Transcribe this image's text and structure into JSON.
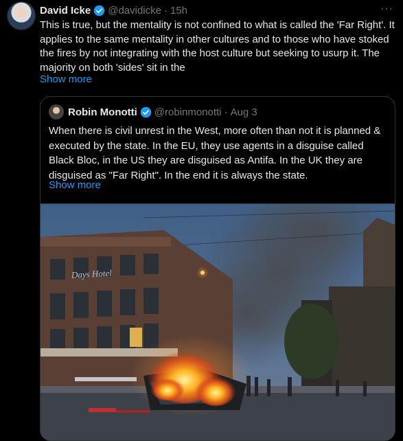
{
  "tweet": {
    "author_name": "David Icke",
    "handle": "@davidicke",
    "time": "15h",
    "text": "This is true, but the mentality is not confined to what is called the 'Far Right'. It applies to the same mentality in other cultures and to those who have stoked the fires by not integrating with the host culture but seeking to usurp it. The majority on both 'sides' sit in the",
    "show_more": "Show more",
    "more_icon": "···"
  },
  "quote": {
    "author_name": "Robin Monotti",
    "handle": "@robinmonotti",
    "date": "Aug 3",
    "text": "When there is civil unrest in the West, more often than not it is planned & executed by the state. In the EU, they use agents in a disguise called Black Bloc, in the US they are disguised as Antifa. In the UK they are disguised as \"Far Right\". In the end it is always the state.",
    "show_more": "Show more"
  },
  "photo": {
    "building_sign": "Days Hotel"
  },
  "colors": {
    "background": "#000000",
    "text": "#e7e9ea",
    "muted": "#71767b",
    "link": "#1d9bf0",
    "border": "#2f3336",
    "verified": "#1d9bf0"
  }
}
